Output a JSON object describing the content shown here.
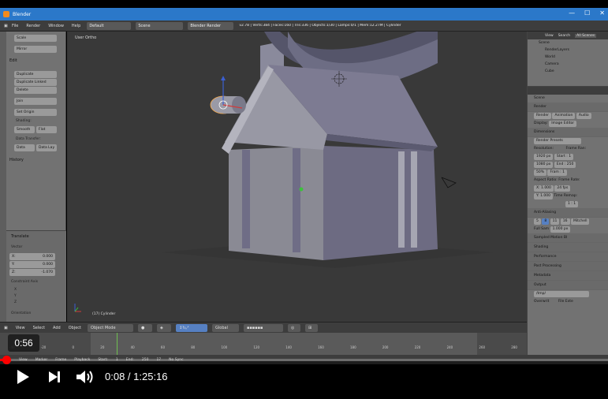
{
  "window": {
    "title": "Blender",
    "minimize": "—",
    "maximize": "☐",
    "close": "✕"
  },
  "menubar": {
    "items": [
      "File",
      "Render",
      "Window",
      "Help"
    ],
    "layout": "Default",
    "scene": "Scene",
    "engine": "Blender Render",
    "stats": "v2.78 | Verts:384 | Faces:160 | Tris:336 | Objects:1/30 | Lamps:0/1 | Mem:12.27M | Cylinder"
  },
  "toolshelf": {
    "buttons": [
      "Scale",
      "Mirror",
      "Duplicate",
      "Duplicate Linked",
      "Delete",
      "Join",
      "Set Origin"
    ],
    "edit_header": "Edit",
    "shading_label": "Shading:",
    "smooth": "Smooth",
    "flat": "Flat",
    "data_transfer_label": "Data Transfer:",
    "data": "Data",
    "data_lay": "Data Lay",
    "history": "History",
    "op_header": "Translate",
    "vector_label": "Vector",
    "x": "X:",
    "x_val": "0.000",
    "y": "Y:",
    "y_val": "0.000",
    "z": "Z:",
    "z_val": "-1.070",
    "constraint_label": "Constraint Axis",
    "cx": "X",
    "cy": "Y",
    "cz": "Z",
    "orientation": "Orientation"
  },
  "viewport": {
    "view_label": "User Ortho",
    "object_label": "(17) Cylinder"
  },
  "outliner": {
    "tabs": [
      "View",
      "Search",
      "All Scenes"
    ],
    "rows": [
      "Scene",
      "RenderLayers",
      "World",
      "Camera",
      "Cube"
    ]
  },
  "properties": {
    "scene": "Scene",
    "render": "Render",
    "render_btns": [
      "Render",
      "Animation",
      "Audio"
    ],
    "display_label": "Display:",
    "display_val": "Image Editor",
    "dimensions": "Dimensions",
    "presets": "Render Presets",
    "resolution_label": "Resolution:",
    "frame_range_label": "Frame Ran:",
    "res_x": "1920 px",
    "res_y": "1080 px",
    "res_pct": "50%",
    "start": "Start : 1",
    "end": "End : 250",
    "frame": "Fram : 1",
    "aspect_label": "Aspect Ratio:",
    "frame_rate_label": "Frame Rate:",
    "asp_x": "X: 1.000",
    "asp_y": "Y: 1.000",
    "fps": "24 fps",
    "time_remap": "Time Remap:",
    "remap": "1 : 1",
    "aa": "Anti-Aliasing",
    "aa_vals": [
      "5",
      "8",
      "11",
      "16"
    ],
    "filter": "Mitchell",
    "full_sample": "Full Sam",
    "full_sample_val": "1.000 px",
    "panels": [
      "Sampled Motion Bl",
      "Shading",
      "Performance",
      "Post Processing",
      "Metadata",
      "Output"
    ],
    "output_path": "/tmp/",
    "overwrite": "Overwrit",
    "file_ext": "File Exte"
  },
  "view_header": {
    "items": [
      "View",
      "Select",
      "Add",
      "Object"
    ],
    "mode": "Object Mode",
    "orientation": "Global"
  },
  "timeline": {
    "ticks": [
      "-40",
      "-20",
      "0",
      "20",
      "40",
      "60",
      "80",
      "100",
      "120",
      "140",
      "160",
      "180",
      "200",
      "220",
      "240",
      "260",
      "280"
    ],
    "header_items": [
      "View",
      "Marker",
      "Frame",
      "Playback",
      "Start:",
      "1",
      "End:",
      "250",
      "17",
      "No Sync"
    ]
  },
  "player": {
    "tooltip_time": "0:56",
    "current": "0:08 / 1:25:16",
    "progress": 0.0016
  }
}
